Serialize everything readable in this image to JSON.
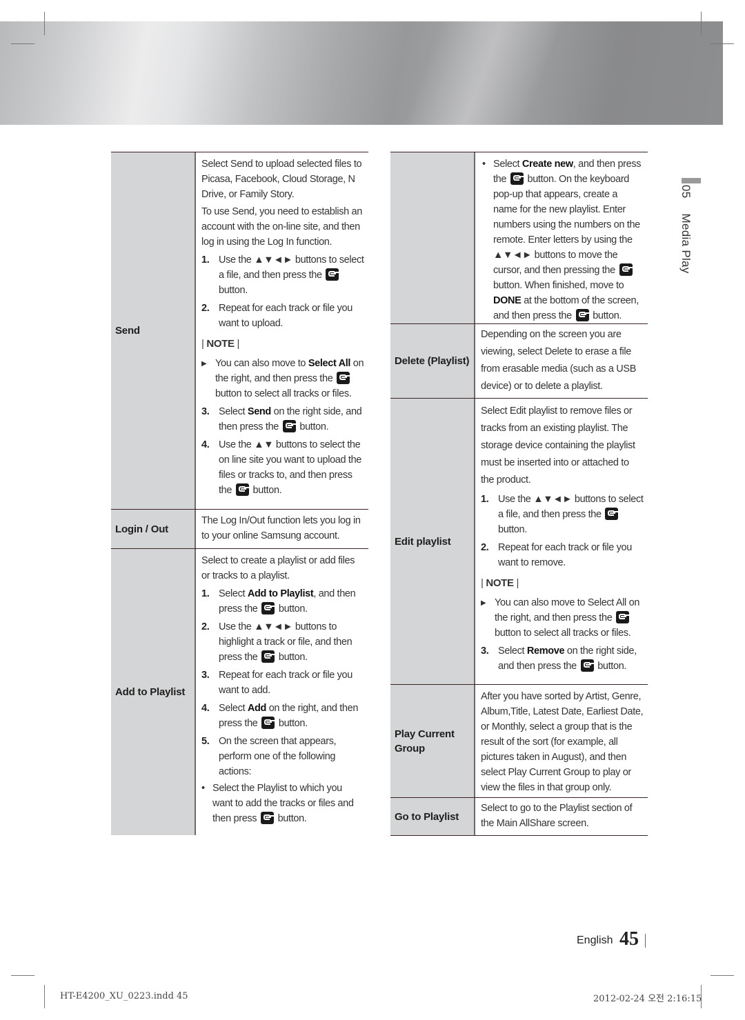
{
  "section": {
    "number": "05",
    "title": "Media Play"
  },
  "note_label": "NOTE",
  "button_word": "button.",
  "left_table": {
    "rows": [
      {
        "label": "Send",
        "paragraphs": [
          "Select Send to upload selected files to Picasa, Facebook, Cloud Storage, N Drive, or Family Story.",
          "To use Send, you need to establish an account with the on-line site, and then log in using the Log In function."
        ],
        "steps": [
          {
            "num": "1.",
            "pre": "Use the ▲▼◄► buttons to select a file, and then press the",
            "post": "button."
          },
          {
            "num": "2.",
            "text": "Repeat for each track or file you want to upload."
          }
        ],
        "note": {
          "pre": "You can also move to",
          "bold": "Select All",
          "mid": "on the right, and then press the",
          "post": "button to select all tracks or files."
        },
        "steps2": [
          {
            "num": "3.",
            "pre": "Select",
            "bold": "Send",
            "mid": "on the right side, and then press the",
            "post": "button."
          },
          {
            "num": "4.",
            "pre": "Use the ▲▼ buttons to select the on line site you want to upload the files or tracks to, and then press the",
            "post": "button."
          }
        ]
      },
      {
        "label": "Login / Out",
        "text": "The Log In/Out function lets you log in to your online Samsung account."
      },
      {
        "label": "Add to Playlist",
        "intro": "Select to create a playlist or add files or tracks to a playlist.",
        "steps": [
          {
            "num": "1.",
            "pre": "Select",
            "bold": "Add to Playlist",
            "mid": ", and then press the",
            "post": "button."
          },
          {
            "num": "2.",
            "pre": "Use the ▲▼◄► buttons to highlight a track or file, and then press the",
            "post": "button."
          },
          {
            "num": "3.",
            "text": "Repeat for each track or file you want to add."
          },
          {
            "num": "4.",
            "pre": "Select",
            "bold": "Add",
            "mid": "on the right, and then press the",
            "post": "button."
          },
          {
            "num": "5.",
            "text": "On the screen that appears, perform one of the following actions:"
          }
        ],
        "bullet": {
          "pre": "Select the Playlist to which you want to add the tracks or files and then press",
          "post": "button."
        }
      }
    ]
  },
  "right_table": {
    "rows": [
      {
        "label": "",
        "bullet": {
          "a": "Select",
          "b_bold": "Create new",
          "c": ", and then press the",
          "d": "button. On the keyboard pop-up that appears, create a name for the new playlist. Enter numbers using the numbers on the remote. Enter letters by using the ▲▼◄► buttons to move the cursor, and then pressing the",
          "e": "button. When finished, move to",
          "f_bold": "DONE",
          "g": "at the bottom of the screen, and then press the",
          "h": "button."
        }
      },
      {
        "label": "Delete (Playlist)",
        "text": "Depending on the screen you are viewing, select Delete to erase a file from erasable media (such as a USB device) or to delete a playlist."
      },
      {
        "label": "Edit playlist",
        "intro": "Select Edit playlist to remove files or tracks from an existing playlist. The storage device containing the playlist must be inserted into or attached to the product.",
        "steps": [
          {
            "num": "1.",
            "pre": "Use the ▲▼◄► buttons to select a file, and then press the",
            "post": "button."
          },
          {
            "num": "2.",
            "text": "Repeat for each track or file you want to remove."
          }
        ],
        "note": {
          "pre": "You can also move to Select All on the right, and then press the",
          "post": "button to select all tracks or files."
        },
        "steps2": [
          {
            "num": "3.",
            "pre": "Select",
            "bold": "Remove",
            "mid": "on the right side, and then press the",
            "post": "button."
          }
        ]
      },
      {
        "label": "Play Current Group",
        "text": "After you have sorted by Artist, Genre, Album,Title, Latest Date, Earliest Date, or Monthly, select a group that is the result of the sort (for example, all pictures taken in August), and then select Play Current Group to play or view the files in that group only."
      },
      {
        "label": "Go to Playlist",
        "text": "Select to go to the Playlist section of the Main AllShare screen."
      }
    ]
  },
  "footer": {
    "language": "English",
    "page": "45",
    "slug_file": "HT-E4200_XU_0223.indd   45",
    "slug_date": "2012-02-24   오전 2:16:15"
  }
}
